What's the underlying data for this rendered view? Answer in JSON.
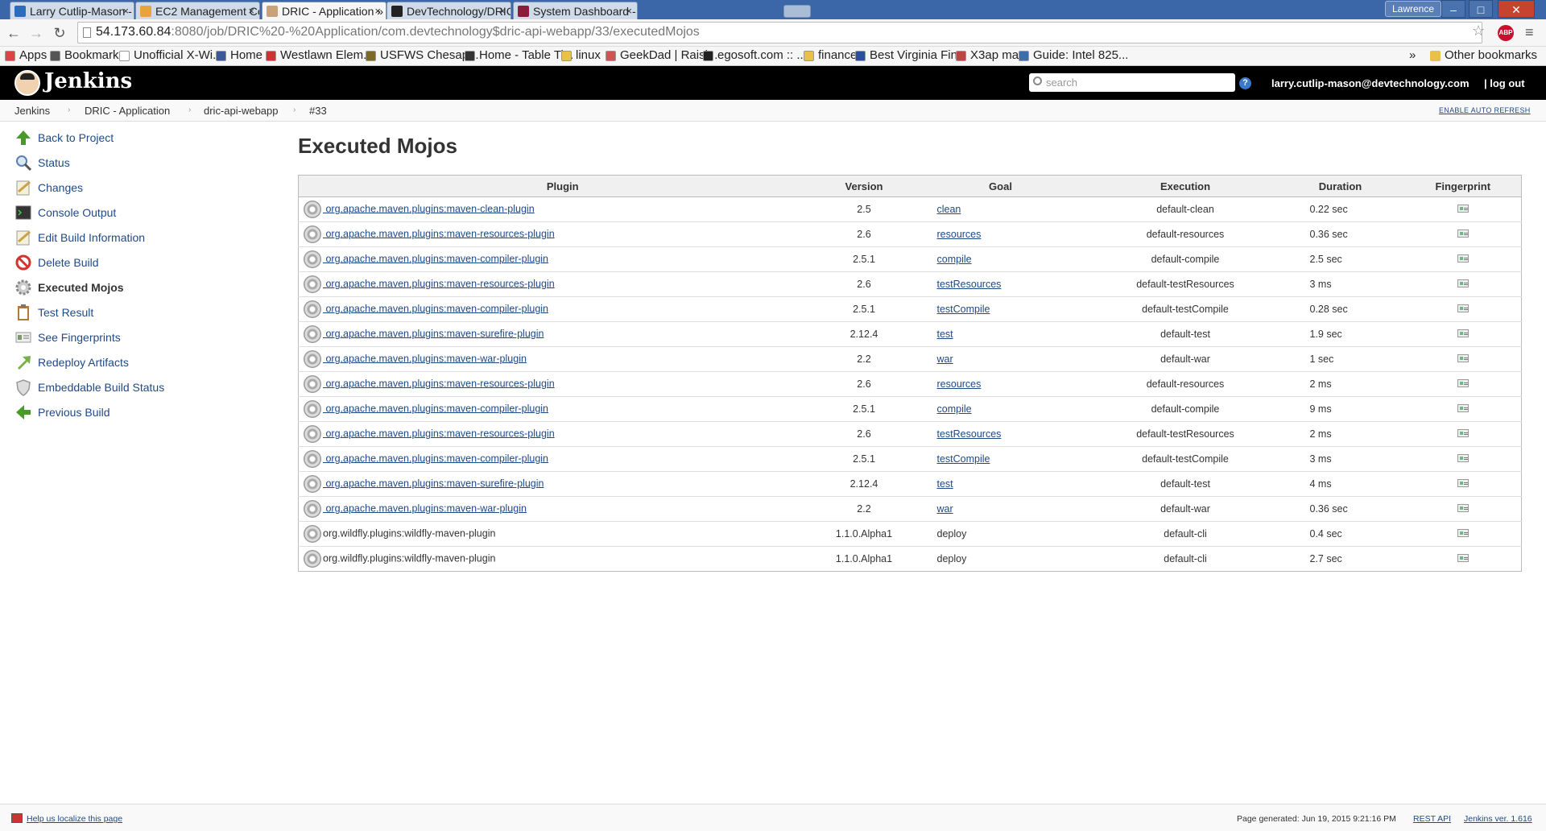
{
  "browser": {
    "tabs": [
      {
        "title": "Larry Cutlip-Mason -",
        "favicon_color": "#2a6ebb",
        "active": false
      },
      {
        "title": "EC2 Management Co",
        "favicon_color": "#e8a33d",
        "active": false
      },
      {
        "title": "DRIC - Application »",
        "favicon_color": "#c9a27a",
        "active": true
      },
      {
        "title": "DevTechnology/DRIC",
        "favicon_color": "#222222",
        "active": false
      },
      {
        "title": "System Dashboard -",
        "favicon_color": "#8b1d3b",
        "active": false
      }
    ],
    "tab_close": "×",
    "profile_name": "Lawrence",
    "url_host": "54.173.60.84",
    "url_path": ":8080/job/DRIC%20-%20Application/com.devtechnology$dric-api-webapp/33/executedMojos",
    "abp_label": "ABP",
    "bookmarks": [
      {
        "label": "Apps",
        "color": "#d44"
      },
      {
        "label": "Bookmarks",
        "color": "#555"
      },
      {
        "label": "Unofficial X-Wi...",
        "color": "#ffffff"
      },
      {
        "label": "Home",
        "color": "#3b5998"
      },
      {
        "label": "Westlawn Elem...",
        "color": "#c33"
      },
      {
        "label": "USFWS Chesap...",
        "color": "#7a6a2a"
      },
      {
        "label": "Home - Table Ti...",
        "color": "#333"
      },
      {
        "label": "linux",
        "color": "#e8c04a"
      },
      {
        "label": "GeekDad | Raisi...",
        "color": "#c55"
      },
      {
        "label": "egosoft.com :: ...",
        "color": "#222"
      },
      {
        "label": "finance",
        "color": "#e8c04a"
      },
      {
        "label": "Best Virginia Fin...",
        "color": "#2a4f9c"
      },
      {
        "label": "X3ap map",
        "color": "#b44"
      },
      {
        "label": "Guide: Intel 825...",
        "color": "#3d6ea8"
      }
    ],
    "bookmarks_more": "»",
    "other_bookmarks": "Other bookmarks"
  },
  "jenkins": {
    "title": "Jenkins",
    "search_placeholder": "search",
    "help": "?",
    "user": "larry.cutlip-mason@devtechnology.com",
    "logout": "| log out",
    "breadcrumbs": [
      "Jenkins",
      "DRIC - Application",
      "dric-api-webapp",
      "#33"
    ],
    "auto_refresh": "ENABLE AUTO REFRESH"
  },
  "sidebar": {
    "items": [
      {
        "label": "Back to Project",
        "icon": "up-arrow-icon",
        "color": "#4a9a2a"
      },
      {
        "label": "Status",
        "icon": "search-icon",
        "color": "#5a7fb0"
      },
      {
        "label": "Changes",
        "icon": "notepad-icon",
        "color": "#c9a24a"
      },
      {
        "label": "Console Output",
        "icon": "terminal-icon",
        "color": "#333333"
      },
      {
        "label": "Edit Build Information",
        "icon": "notepad-icon",
        "color": "#c9a24a"
      },
      {
        "label": "Delete Build",
        "icon": "no-entry-icon",
        "color": "#d0342c"
      },
      {
        "label": "Executed Mojos",
        "icon": "gear-icon",
        "color": "#888888"
      },
      {
        "label": "Test Result",
        "icon": "clipboard-icon",
        "color": "#b47a3a"
      },
      {
        "label": "See Fingerprints",
        "icon": "fingerprint-icon",
        "color": "#7a9a6a"
      },
      {
        "label": "Redeploy Artifacts",
        "icon": "redeploy-icon",
        "color": "#7ab04a"
      },
      {
        "label": "Embeddable Build Status",
        "icon": "shield-icon",
        "color": "#999999"
      },
      {
        "label": "Previous Build",
        "icon": "left-arrow-icon",
        "color": "#4a9a2a"
      }
    ]
  },
  "main": {
    "title": "Executed Mojos",
    "columns": [
      "Plugin",
      "Version",
      "Goal",
      "Execution",
      "Duration",
      "Fingerprint"
    ],
    "rows": [
      {
        "plugin": " org.apache.maven.plugins:maven-clean-plugin",
        "link": true,
        "version": "2.5",
        "goal": "clean",
        "goal_link": true,
        "execution": "default-clean",
        "duration": "0.22 sec"
      },
      {
        "plugin": " org.apache.maven.plugins:maven-resources-plugin",
        "link": true,
        "version": "2.6",
        "goal": "resources",
        "goal_link": true,
        "execution": "default-resources",
        "duration": "0.36 sec"
      },
      {
        "plugin": " org.apache.maven.plugins:maven-compiler-plugin",
        "link": true,
        "version": "2.5.1",
        "goal": "compile",
        "goal_link": true,
        "execution": "default-compile",
        "duration": "2.5 sec"
      },
      {
        "plugin": " org.apache.maven.plugins:maven-resources-plugin",
        "link": true,
        "version": "2.6",
        "goal": "testResources",
        "goal_link": true,
        "execution": "default-testResources",
        "duration": "3 ms"
      },
      {
        "plugin": " org.apache.maven.plugins:maven-compiler-plugin",
        "link": true,
        "version": "2.5.1",
        "goal": "testCompile",
        "goal_link": true,
        "execution": "default-testCompile",
        "duration": "0.28 sec"
      },
      {
        "plugin": " org.apache.maven.plugins:maven-surefire-plugin",
        "link": true,
        "version": "2.12.4",
        "goal": "test",
        "goal_link": true,
        "execution": "default-test",
        "duration": "1.9 sec"
      },
      {
        "plugin": " org.apache.maven.plugins:maven-war-plugin",
        "link": true,
        "version": "2.2",
        "goal": "war",
        "goal_link": true,
        "execution": "default-war",
        "duration": "1 sec"
      },
      {
        "plugin": " org.apache.maven.plugins:maven-resources-plugin",
        "link": true,
        "version": "2.6",
        "goal": "resources",
        "goal_link": true,
        "execution": "default-resources",
        "duration": "2 ms"
      },
      {
        "plugin": " org.apache.maven.plugins:maven-compiler-plugin",
        "link": true,
        "version": "2.5.1",
        "goal": "compile",
        "goal_link": true,
        "execution": "default-compile",
        "duration": "9 ms"
      },
      {
        "plugin": " org.apache.maven.plugins:maven-resources-plugin",
        "link": true,
        "version": "2.6",
        "goal": "testResources",
        "goal_link": true,
        "execution": "default-testResources",
        "duration": "2 ms"
      },
      {
        "plugin": " org.apache.maven.plugins:maven-compiler-plugin",
        "link": true,
        "version": "2.5.1",
        "goal": "testCompile",
        "goal_link": true,
        "execution": "default-testCompile",
        "duration": "3 ms"
      },
      {
        "plugin": " org.apache.maven.plugins:maven-surefire-plugin",
        "link": true,
        "version": "2.12.4",
        "goal": "test",
        "goal_link": true,
        "execution": "default-test",
        "duration": "4 ms"
      },
      {
        "plugin": " org.apache.maven.plugins:maven-war-plugin",
        "link": true,
        "version": "2.2",
        "goal": "war",
        "goal_link": true,
        "execution": "default-war",
        "duration": "0.36 sec"
      },
      {
        "plugin": "org.wildfly.plugins:wildfly-maven-plugin",
        "link": false,
        "version": "1.1.0.Alpha1",
        "goal": "deploy",
        "goal_link": false,
        "execution": "default-cli",
        "duration": "0.4 sec"
      },
      {
        "plugin": "org.wildfly.plugins:wildfly-maven-plugin",
        "link": false,
        "version": "1.1.0.Alpha1",
        "goal": "deploy",
        "goal_link": false,
        "execution": "default-cli",
        "duration": "2.7 sec"
      }
    ]
  },
  "footer": {
    "localize": "Help us localize this page",
    "page_generated": "Page generated: Jun 19, 2015 9:21:16 PM",
    "rest_api": "REST API",
    "version": "Jenkins ver. 1.616"
  }
}
